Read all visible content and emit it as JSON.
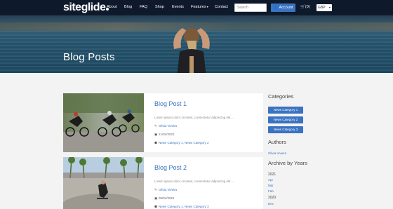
{
  "nav": {
    "logo": "siteglide",
    "links": [
      "About",
      "Blog",
      "FAQ",
      "Shop",
      "Events",
      "Features",
      "Contact"
    ],
    "search_placeholder": "Search",
    "account_label": "Account",
    "cart_label": "(0)",
    "currency": "GBP"
  },
  "hero": {
    "title": "Blog Posts"
  },
  "posts": [
    {
      "title": "Blog Post 1",
      "excerpt": "Lorem ipsum dolor sit amet, consectetur adipiscing elit....",
      "author": "Olivia Viveira",
      "date": "21/04/2021",
      "categories": "News Category 1, News Category 2"
    },
    {
      "title": "Blog Post 2",
      "excerpt": "Lorem ipsum dolor sit amet, consectetur adipiscing elit....",
      "author": "Olivia Viveira",
      "date": "09/04/2021",
      "categories": "News Category 1, News Category 3"
    }
  ],
  "sidebar": {
    "categories_heading": "Categories",
    "categories": [
      "News Category 1",
      "News Category 2",
      "News Category 3"
    ],
    "authors_heading": "Authors",
    "authors": [
      "Olivia Viveira"
    ],
    "archive_heading": "Archive by Years",
    "years": [
      {
        "year": "2021",
        "months": [
          "Apr",
          "Mar",
          "Feb"
        ]
      },
      {
        "year": "2020",
        "months": [
          "Dec"
        ]
      }
    ]
  },
  "colors": {
    "nav_bg": "#0e1a2b",
    "accent": "#3a73c0",
    "page_bg": "#f3f3f3"
  }
}
